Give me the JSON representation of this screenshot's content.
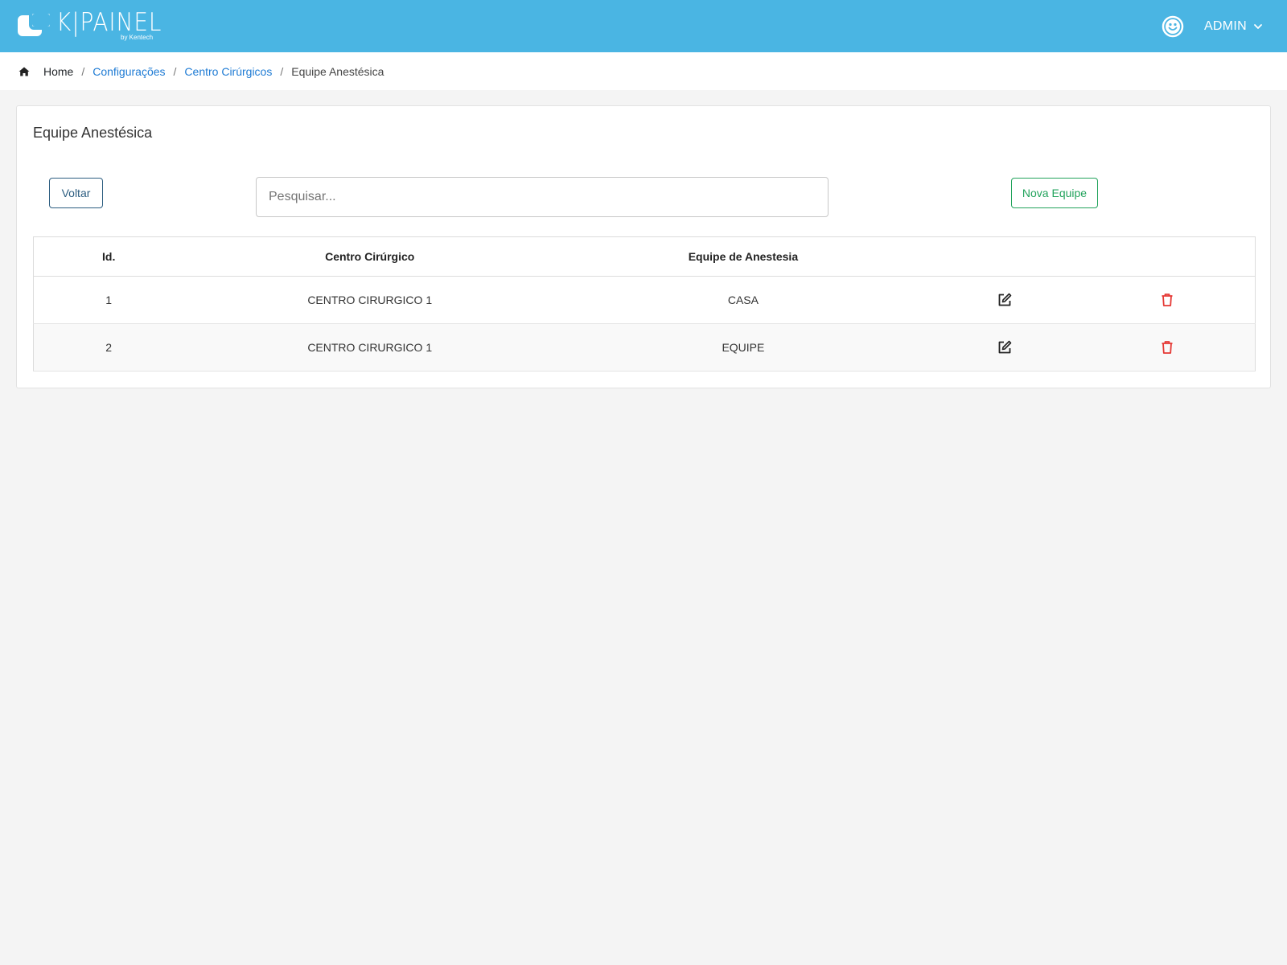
{
  "header": {
    "logo_text": "K|PAINEL",
    "logo_sub": "by Kentech",
    "user_name": "ADMIN"
  },
  "breadcrumb": {
    "home": "Home",
    "items": [
      "Configurações",
      "Centro Cirúrgicos",
      "Equipe Anestésica"
    ]
  },
  "card": {
    "title": "Equipe Anestésica",
    "back_label": "Voltar",
    "new_label": "Nova Equipe",
    "search_placeholder": "Pesquisar..."
  },
  "table": {
    "headers": [
      "Id.",
      "Centro Cirúrgico",
      "Equipe de Anestesia"
    ],
    "rows": [
      {
        "id": "1",
        "centro": "CENTRO CIRURGICO 1",
        "equipe": "CASA"
      },
      {
        "id": "2",
        "centro": "CENTRO CIRURGICO 1",
        "equipe": "EQUIPE"
      }
    ]
  },
  "colors": {
    "topbar": "#4ab5e3",
    "link": "#1e7bd4",
    "back_button": "#2c5d80",
    "new_button": "#22a35c",
    "delete_icon": "#e53935"
  },
  "icons": {
    "user": "smile-icon",
    "edit": "edit-icon",
    "delete": "trash-icon",
    "home": "home-icon"
  }
}
